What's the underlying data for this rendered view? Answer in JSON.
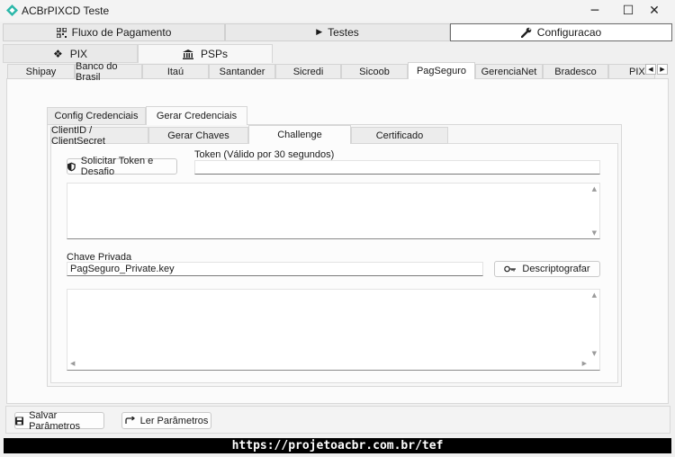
{
  "window": {
    "title": "ACBrPIXCD Teste",
    "minimize": "─",
    "maximize": "☐",
    "close": "✕",
    "accent": "#2bb7a9"
  },
  "top_tabs": [
    {
      "label": "Fluxo de Pagamento",
      "icon": "qr-icon"
    },
    {
      "label": "Testes",
      "icon": "play-icon"
    },
    {
      "label": "Configuracao",
      "icon": "wrench-icon"
    }
  ],
  "second_tabs": [
    {
      "label": "PIX",
      "icon": "pix-icon"
    },
    {
      "label": "PSPs",
      "icon": "bank-icon"
    }
  ],
  "psp_tabs": [
    "Shipay",
    "Banco do Brasil",
    "Itaú",
    "Santander",
    "Sicredi",
    "Sicoob",
    "PagSeguro",
    "GerenciaNet",
    "Bradesco",
    "PIXP"
  ],
  "psp_selected": "PagSeguro",
  "cred_tabs": [
    "Config Credenciais",
    "Gerar Credenciais"
  ],
  "sub_tabs": [
    "ClientID / ClientSecret",
    "Gerar Chaves",
    "Challenge",
    "Certificado"
  ],
  "challenge": {
    "solicitar_label": "Solicitar Token e Desafio",
    "token_label": "Token (Válido por 30 segundos)",
    "token_value": "",
    "chave_label": "Chave Privada",
    "chave_value": "PagSeguro_Private.key",
    "descript_label": "Descriptografar"
  },
  "bottom": {
    "salvar_label": "Salvar Parâmetros",
    "ler_label": "Ler Parâmetros"
  },
  "footer": {
    "text": "https://projetoacbr.com.br/tef"
  }
}
